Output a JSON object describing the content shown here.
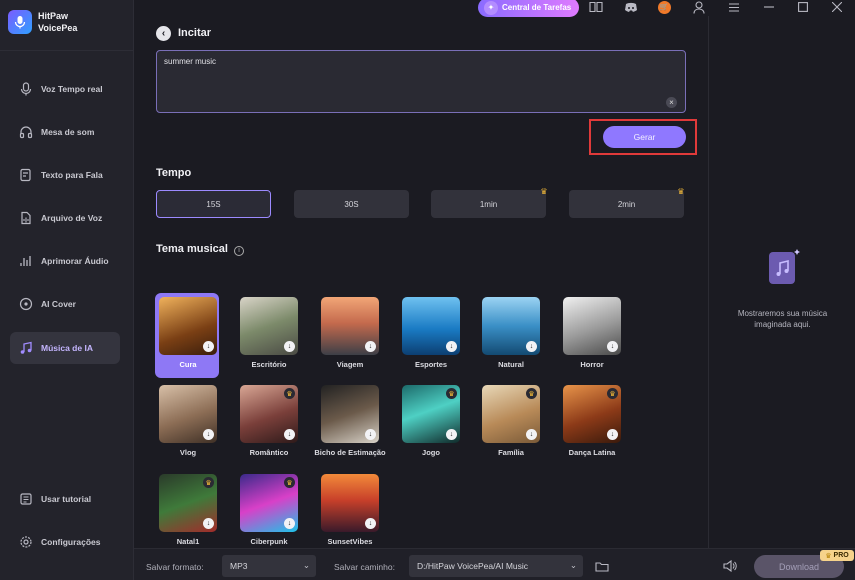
{
  "app": {
    "name_line1": "HitPaw",
    "name_line2": "VoicePea"
  },
  "sidebar": {
    "items": [
      {
        "label": "Voz Tempo real",
        "icon": "microphone-icon"
      },
      {
        "label": "Mesa de som",
        "icon": "headphones-icon"
      },
      {
        "label": "Texto para Fala",
        "icon": "text-speech-icon"
      },
      {
        "label": "Arquivo de Voz",
        "icon": "voice-file-icon"
      },
      {
        "label": "Aprimorar Áudio",
        "icon": "enhance-audio-icon"
      },
      {
        "label": "AI Cover",
        "icon": "ai-cover-icon"
      },
      {
        "label": "Música de IA",
        "icon": "music-note-icon",
        "active": true
      }
    ],
    "bottom": [
      {
        "label": "Usar tutorial",
        "icon": "tutorial-icon"
      },
      {
        "label": "Configurações",
        "icon": "settings-icon"
      }
    ]
  },
  "topbar": {
    "task_center": "Central de Tarefas"
  },
  "main": {
    "prompt_title": "Incitar",
    "prompt_value": "summer music",
    "generate_label": "Gerar",
    "tempo_title": "Tempo",
    "tempo_options": [
      {
        "label": "15S",
        "selected": true,
        "premium": false
      },
      {
        "label": "30S",
        "selected": false,
        "premium": false
      },
      {
        "label": "1min",
        "selected": false,
        "premium": true
      },
      {
        "label": "2min",
        "selected": false,
        "premium": true
      }
    ],
    "theme_title": "Tema musical",
    "themes": [
      {
        "label": "Cura",
        "premium": false,
        "selected": true
      },
      {
        "label": "Escritório",
        "premium": false
      },
      {
        "label": "Viagem",
        "premium": false
      },
      {
        "label": "Esportes",
        "premium": false
      },
      {
        "label": "Natural",
        "premium": false
      },
      {
        "label": "Horror",
        "premium": false
      },
      {
        "label": "Vlog",
        "premium": false
      },
      {
        "label": "Romântico",
        "premium": true
      },
      {
        "label": "Bicho de Estimação",
        "premium": false
      },
      {
        "label": "Jogo",
        "premium": true
      },
      {
        "label": "Família",
        "premium": true
      },
      {
        "label": "Dança Latina",
        "premium": true
      },
      {
        "label": "Natal1",
        "premium": true
      },
      {
        "label": "Ciberpunk",
        "premium": true
      },
      {
        "label": "SunsetVibes",
        "premium": false
      }
    ]
  },
  "right_panel": {
    "empty_text": "Mostraremos sua música imaginada aqui."
  },
  "bottombar": {
    "format_label": "Salvar formato:",
    "format_value": "MP3",
    "path_label": "Salvar caminho:",
    "path_value": "D:/HitPaw VoicePea/AI Music",
    "download_label": "Download",
    "pro_badge": "PRO"
  },
  "colors": {
    "accent": "#8f78ff",
    "highlight_frame": "#e03a3a",
    "premium": "#f1b838"
  }
}
